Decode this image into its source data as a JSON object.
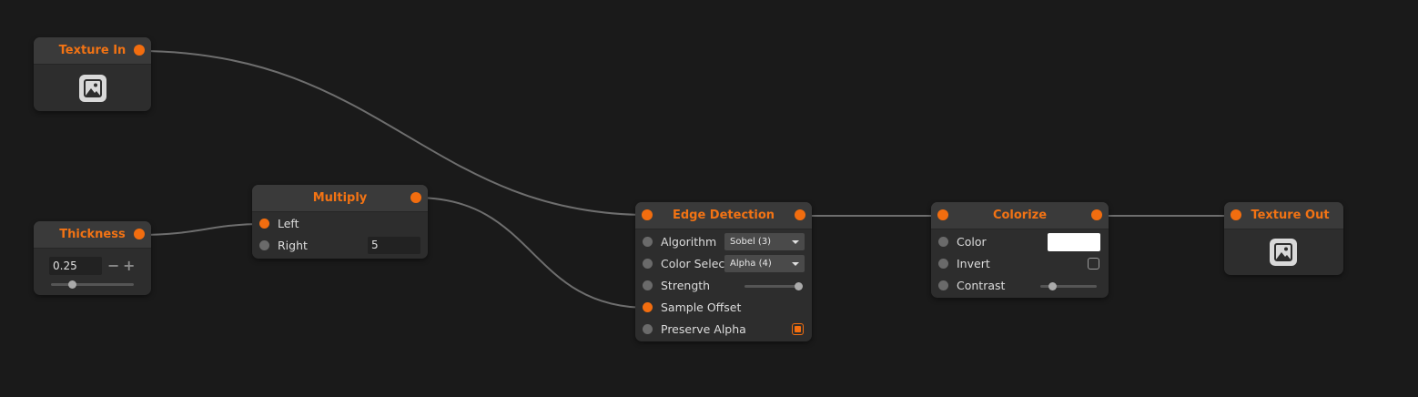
{
  "colors": {
    "accent": "#f26d0f",
    "background": "#1a1a1a",
    "node": "#2d2d2d",
    "wire": "#6e6e6e"
  },
  "nodes": {
    "texture_in": {
      "title": "Texture In",
      "icon": "image-icon"
    },
    "thickness": {
      "title": "Thickness",
      "value": "0.25",
      "minus": "−",
      "plus": "+",
      "slider_value": 0.25
    },
    "multiply": {
      "title": "Multiply",
      "left_label": "Left",
      "right_label": "Right",
      "right_value": "5"
    },
    "edge_detection": {
      "title": "Edge Detection",
      "algorithm_label": "Algorithm",
      "algorithm_value": "Sobel (3)",
      "color_select_label": "Color Select",
      "color_select_value": "Alpha (4)",
      "strength_label": "Strength",
      "strength_value": 1.0,
      "sample_offset_label": "Sample Offset",
      "preserve_alpha_label": "Preserve Alpha",
      "preserve_alpha_checked": true
    },
    "colorize": {
      "title": "Colorize",
      "color_label": "Color",
      "color_value": "#ffffff",
      "invert_label": "Invert",
      "invert_checked": false,
      "contrast_label": "Contrast",
      "contrast_value": 0.2
    },
    "texture_out": {
      "title": "Texture Out",
      "icon": "image-icon"
    }
  }
}
